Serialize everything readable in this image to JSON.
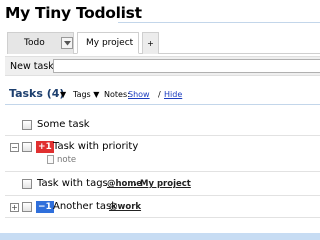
{
  "app": {
    "title": "My Tiny Todolist"
  },
  "tabs": [
    {
      "label": "Todo"
    },
    {
      "label": "My project"
    },
    {
      "label": "+"
    }
  ],
  "new_task": {
    "label": "New task",
    "value": ""
  },
  "tasks_header": {
    "title": "Tasks (4)",
    "sort_arrow": "▼",
    "tags_label": "Tags ▼",
    "notes_label": "Notes:",
    "notes_show": "Show",
    "notes_sep": "/",
    "notes_hide": "Hide"
  },
  "tasks": [
    {
      "title": "Some task",
      "priority": "",
      "tags": [],
      "note": ""
    },
    {
      "title": "Task with priority",
      "priority": "+1",
      "tags": [],
      "note": "note",
      "expander": "⊟"
    },
    {
      "title": "Task with tags",
      "priority": "",
      "tags": [
        "@home",
        "My project"
      ],
      "tag_sep": ",",
      "note": ""
    },
    {
      "title": "Another task",
      "priority": "−1",
      "tags": [
        "@work"
      ],
      "note": "",
      "expander": "⊞"
    }
  ],
  "colors": {
    "header_blue": "#1d3f6e",
    "link_blue": "#1a3bbf",
    "priority_high": "#e03030",
    "priority_low": "#2f6fdb",
    "accent_line": "#c3d6ea"
  }
}
